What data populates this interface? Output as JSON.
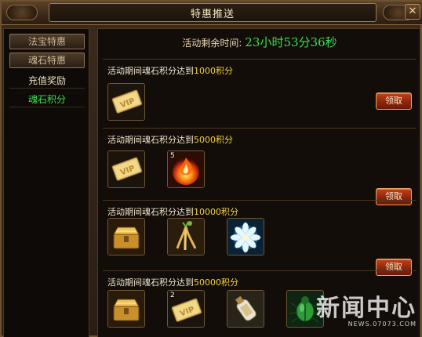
{
  "window": {
    "title": "特惠推送",
    "close_label": "✕"
  },
  "sidebar": {
    "items": [
      {
        "label": "法宝特惠",
        "style": "button"
      },
      {
        "label": "魂石特惠",
        "style": "button"
      },
      {
        "label": "充值奖励",
        "style": "link"
      },
      {
        "label": "魂石积分",
        "style": "link",
        "active": true
      }
    ]
  },
  "timer": {
    "label": "活动剩余时间:",
    "value": "23小时53分36秒"
  },
  "tiers": [
    {
      "prefix": "活动期间魂石积分达到",
      "amount": "1000",
      "suffix": "积分",
      "claim_label": "领取",
      "rewards": [
        {
          "icon": "vip-card-icon",
          "count": ""
        }
      ]
    },
    {
      "prefix": "活动期间魂石积分达到",
      "amount": "5000",
      "suffix": "积分",
      "claim_label": "领取",
      "rewards": [
        {
          "icon": "vip-card-icon",
          "count": ""
        },
        {
          "icon": "fire-orb-icon",
          "count": "5"
        }
      ]
    },
    {
      "prefix": "活动期间魂石积分达到",
      "amount": "10000",
      "suffix": "积分",
      "claim_label": "领取",
      "rewards": [
        {
          "icon": "treasure-chest-icon",
          "count": ""
        },
        {
          "icon": "ginseng-icon",
          "count": ""
        },
        {
          "icon": "lotus-flower-icon",
          "count": ""
        }
      ]
    },
    {
      "prefix": "活动期间魂石积分达到",
      "amount": "50000",
      "suffix": "积分",
      "claim_label": "",
      "rewards": [
        {
          "icon": "treasure-chest-icon",
          "count": ""
        },
        {
          "icon": "vip-card-icon",
          "count": "2"
        },
        {
          "icon": "message-bottle-icon",
          "count": ""
        },
        {
          "icon": "green-beetle-icon",
          "count": ""
        }
      ]
    }
  ],
  "watermark": {
    "main": "新闻中心",
    "sub": "NEWS.07073.COM"
  },
  "colors": {
    "accent_green": "#38e04c",
    "amount_yellow": "#f3d33b",
    "claim_red": "#a8300f"
  }
}
